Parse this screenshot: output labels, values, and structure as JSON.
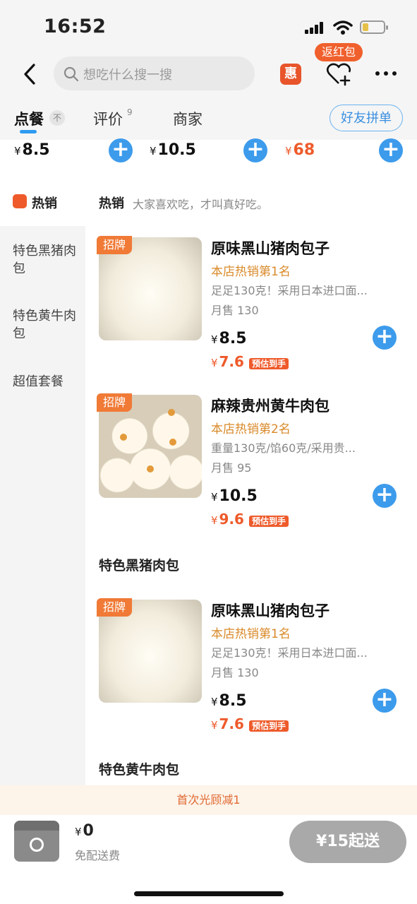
{
  "status_bar": {
    "time": "16:52"
  },
  "search": {
    "placeholder": "想吃什么搜一搜"
  },
  "header": {
    "hui_label": "惠",
    "red_packet_label": "返红包"
  },
  "tabs": {
    "order": "点餐",
    "order_pin": "不",
    "reviews": "评价",
    "reviews_count": "9",
    "merchant": "商家",
    "group_order": "好友拼单"
  },
  "strip": {
    "currency": "¥",
    "prices": [
      "8.5",
      "10.5",
      "68"
    ],
    "third_color": "#ee5a2a"
  },
  "sidebar": {
    "hot": "热销",
    "items": [
      "特色黑猪肉包",
      "特色黄牛肉包",
      "超值套餐"
    ]
  },
  "sections": {
    "hot_title": "热销",
    "hot_desc": "大家喜欢吃，才叫真好吃。",
    "black_pork": "特色黑猪肉包",
    "yellow_beef": "特色黄牛肉包"
  },
  "products": [
    {
      "badge": "招牌",
      "name": "原味黑山猪肉包子",
      "rank": "本店热销第1名",
      "desc": "足足130克！采用日本进口面...",
      "sales": "月售 130",
      "price": "8.5",
      "disc_price": "7.6",
      "disc_tag": "预估到手"
    },
    {
      "badge": "招牌",
      "name": "麻辣贵州黄牛肉包",
      "rank": "本店热销第2名",
      "desc": "重量130克/馅60克/采用贵...",
      "sales": "月售 95",
      "price": "10.5",
      "disc_price": "9.6",
      "disc_tag": "预估到手"
    },
    {
      "badge": "招牌",
      "name": "原味黑山猪肉包子",
      "rank": "本店热销第1名",
      "desc": "足足130克！采用日本进口面...",
      "sales": "月售 130",
      "price": "8.5",
      "disc_price": "7.6",
      "disc_tag": "预估到手"
    }
  ],
  "promo": "首次光顾减1",
  "cart": {
    "total": "0",
    "currency": "¥",
    "delivery_note": "免配送费",
    "min_order": "¥15起送"
  },
  "colors": {
    "accent": "#3d9bec",
    "discount": "#ee5a2a",
    "rank": "#d98a2a"
  }
}
